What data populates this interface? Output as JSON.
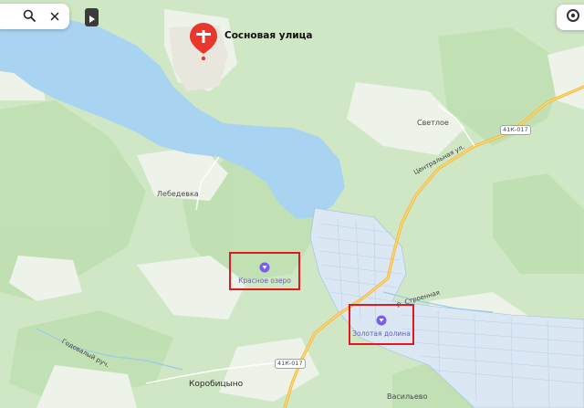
{
  "search_bar": {
    "search_icon": "search-icon",
    "close_icon": "close-icon"
  },
  "panel_toggle": {
    "icon": "play-triangle-icon"
  },
  "corner_control": {
    "icon": "ring-icon"
  },
  "selected_place": {
    "label": "Сосновая улица",
    "icon": "geo-pin-icon"
  },
  "settlements": {
    "svetloe": "Светлое",
    "lebedevka": "Лебедевка",
    "korobitsyno": "Коробицыно",
    "vasilevo": "Васильево"
  },
  "streets": {
    "tsentralnaya": "Центральная ул.",
    "r_stroennaya": "р. Строенная",
    "godovaya": "Годовалый руч."
  },
  "road_badges": [
    "41К-017",
    "41К-017"
  ],
  "pois": {
    "krasnoe_ozero": "Красное озеро",
    "zolotaya_dolina": "Золотая долина"
  },
  "colors": {
    "water": "#a8d4f2",
    "forest": "#c8e6bd",
    "open_land": "#eef3e9",
    "road": "#f5c24c",
    "highlight": "#e0191f",
    "pin": "#e8372c",
    "poi": "#7b5ee8"
  }
}
